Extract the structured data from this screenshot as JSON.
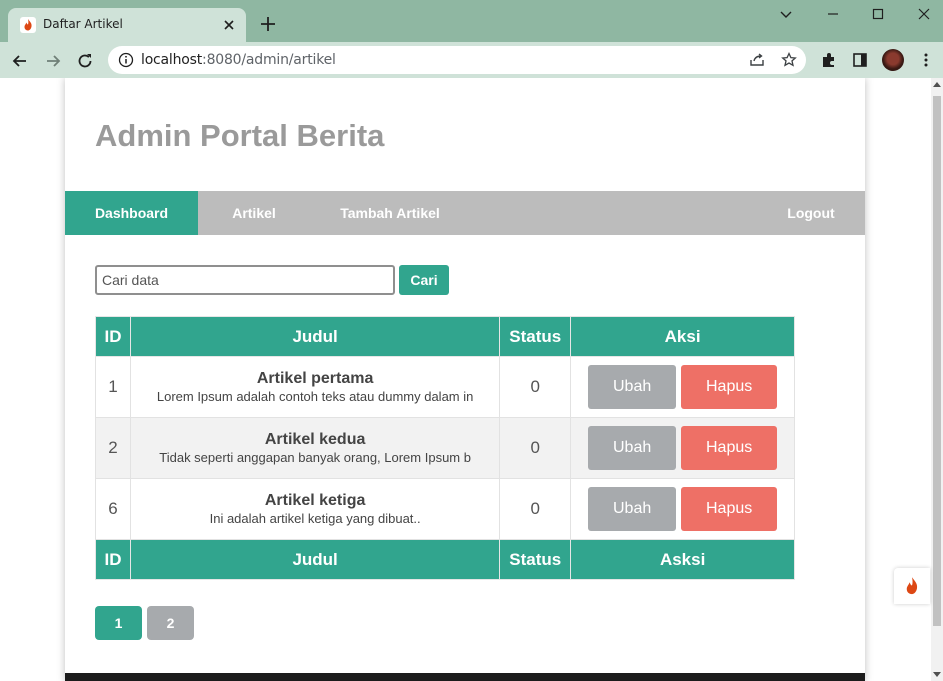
{
  "browser": {
    "tab_title": "Daftar Artikel",
    "url_host": "localhost",
    "url_rest": ":8080/admin/artikel"
  },
  "page": {
    "site_title": "Admin Portal Berita",
    "nav": {
      "dashboard": "Dashboard",
      "artikel": "Artikel",
      "tambah": "Tambah Artikel",
      "logout": "Logout"
    },
    "search": {
      "placeholder": "Cari data",
      "button": "Cari"
    },
    "table": {
      "headers": [
        "ID",
        "Judul",
        "Status",
        "Aksi"
      ],
      "footers": [
        "ID",
        "Judul",
        "Status",
        "Asksi"
      ],
      "rows": [
        {
          "id": "1",
          "title": "Artikel pertama",
          "excerpt": "Lorem Ipsum adalah contoh teks atau dummy dalam in",
          "status": "0",
          "edit": "Ubah",
          "delete": "Hapus"
        },
        {
          "id": "2",
          "title": "Artikel kedua",
          "excerpt": "Tidak seperti anggapan banyak orang, Lorem Ipsum b",
          "status": "0",
          "edit": "Ubah",
          "delete": "Hapus"
        },
        {
          "id": "6",
          "title": "Artikel ketiga",
          "excerpt": "Ini adalah artikel ketiga yang dibuat..",
          "status": "0",
          "edit": "Ubah",
          "delete": "Hapus"
        }
      ]
    },
    "pagination": [
      "1",
      "2"
    ]
  },
  "colors": {
    "accent": "#31a58e",
    "nav_bg": "#bcbcbc",
    "edit_btn": "#a7aaad",
    "delete_btn": "#ee7066",
    "title_gray": "#9a9a9a"
  }
}
